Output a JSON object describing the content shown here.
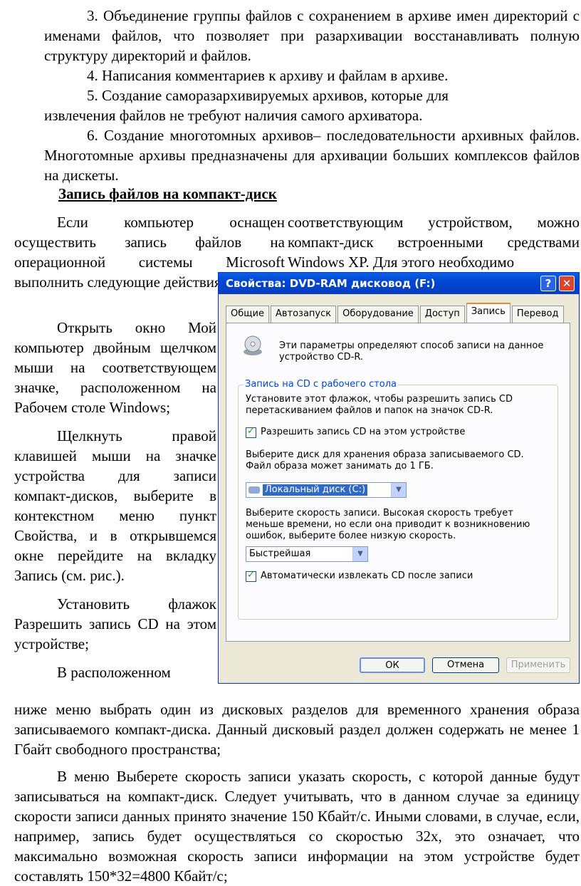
{
  "doc": {
    "p3": "3. Объединение группы файлов с сохранением в архиве имен директорий с именами файлов, что позволяет при разархивации восстанавливать полную структуру директорий и файлов.",
    "p4": "4. Написания комментариев к архиву и файлам в архиве.",
    "p5a": "5. Создание саморазархивируемых архивов, которые для",
    "p5b": "извлечения файлов не требуют наличия самого архиватора.",
    "p6": "6. Создание многотомных архивов– последовательности архивных файлов. Многотомные архивы предназначены для архивации больших комплексов файлов на дискеты.",
    "heading": "Запись файлов на компакт-диск",
    "left_intro": "Если компьютер оснащен осуществить запись файлов на операционной системы Microsoft выполнить следующие действия:",
    "right_intro": "соответствующим устройством, можно компакт-диск встроенными средствами Windows XP. Для этого необходимо",
    "step1": "Открыть окно Мой компьютер двойным щелчком мыши на соответствующем значке, расположенном на Рабочем столе Windows;",
    "step2": "Щелкнуть правой клавишей мыши на значке устройства для записи компакт-дисков, выберите в контекстном меню пункт Свойства, и в открывшемся окне перейдите на вкладку Запись (см. рис.).",
    "step3": "Установить флажок Разрешить запись CD на этом устройстве;",
    "step4a": "В расположенном",
    "step4b": "ниже меню выбрать один из дисковых разделов для временного хранения образа записываемого компакт-диска. Данный дисковый раздел должен содержать не менее 1 Гбайт свободного пространства;",
    "speed": "В меню Выберете скорость записи указать скорость, с которой данные будут записываться на компакт-диск. Следует учитывать, что в данном случае за единицу скорости записи данных принято значение 150 Кбайт/с. Иными словами, в случае, если, например, запись будет осуществляться со скоростью 32х, это означает, что максимально возможная скорость записи информации на этом устройстве будет составлять 150*32=4800 Кбайт/с;"
  },
  "window": {
    "title": "Свойства: DVD-RAM дисковод (F:)",
    "help": "?",
    "close": "✕",
    "tabs": [
      "Общие",
      "Автозапуск",
      "Оборудование",
      "Доступ",
      "Запись",
      "Перевод"
    ],
    "intro": "Эти параметры определяют способ записи на данное устройство CD-R.",
    "group_label": "Запись на CD с рабочего стола",
    "group_text": "Установите этот флажок, чтобы разрешить запись CD перетаскиванием файлов и папок на значок CD-R.",
    "enable_label": "Разрешить запись CD на этом устройстве",
    "disk_text": "Выберите диск для хранения образа записываемого CD. Файл образа может занимать до 1 ГБ.",
    "disk_value": "Локальный диск (C:)",
    "speed_text": "Выберите скорость записи. Высокая скорость требует меньше времени, но если она приводит к возникновению ошибок, выберите более низкую скорость.",
    "speed_value": "Быстрейшая",
    "eject_label": "Автоматически извлекать CD после записи",
    "ok": "ОК",
    "cancel": "Отмена",
    "apply": "Применить"
  }
}
